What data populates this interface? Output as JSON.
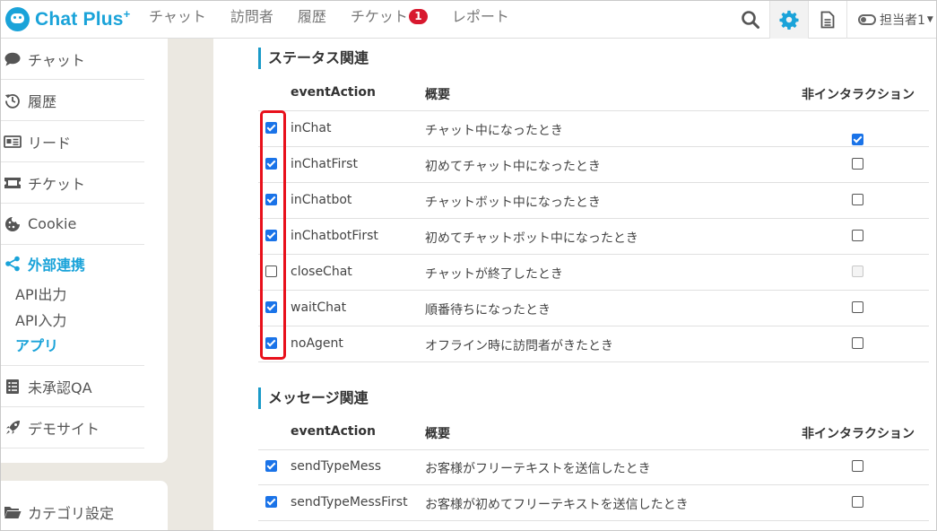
{
  "header": {
    "app_name": "Chat Plus",
    "app_plus": "+",
    "nav": [
      {
        "label": "チャット"
      },
      {
        "label": "訪問者"
      },
      {
        "label": "履歴"
      },
      {
        "label": "チケット",
        "badge": "1"
      },
      {
        "label": "レポート"
      }
    ],
    "user_label": "担当者1"
  },
  "sidebar": {
    "items": [
      {
        "label": "チャット",
        "icon": "speech-bubble-icon"
      },
      {
        "label": "履歴",
        "icon": "history-icon"
      },
      {
        "label": "リード",
        "icon": "id-card-icon"
      },
      {
        "label": "チケット",
        "icon": "ticket-icon"
      },
      {
        "label": "Cookie",
        "icon": "cookie-icon"
      },
      {
        "label": "外部連携",
        "icon": "share-icon",
        "active": true
      },
      {
        "label": "未承認QA",
        "icon": "checklist-icon"
      },
      {
        "label": "デモサイト",
        "icon": "rocket-icon"
      }
    ],
    "sub_items": [
      {
        "label": "API出力"
      },
      {
        "label": "API入力"
      },
      {
        "label": "アプリ",
        "active": true
      }
    ],
    "bottom_item": {
      "label": "カテゴリ設定",
      "icon": "folder-icon"
    }
  },
  "sections": [
    {
      "title": "ステータス関連",
      "columns": {
        "event": "eventAction",
        "desc": "概要",
        "noninteraction": "非インタラクション"
      },
      "rows": [
        {
          "enabled": true,
          "event": "inChat",
          "desc": "チャット中になったとき",
          "noninteraction": "checked"
        },
        {
          "enabled": true,
          "event": "inChatFirst",
          "desc": "初めてチャット中になったとき",
          "noninteraction": "unchecked"
        },
        {
          "enabled": true,
          "event": "inChatbot",
          "desc": "チャットボット中になったとき",
          "noninteraction": "unchecked"
        },
        {
          "enabled": true,
          "event": "inChatbotFirst",
          "desc": "初めてチャットボット中になったとき",
          "noninteraction": "unchecked"
        },
        {
          "enabled": false,
          "event": "closeChat",
          "desc": "チャットが終了したとき",
          "noninteraction": "disabled"
        },
        {
          "enabled": true,
          "event": "waitChat",
          "desc": "順番待ちになったとき",
          "noninteraction": "unchecked"
        },
        {
          "enabled": true,
          "event": "noAgent",
          "desc": "オフライン時に訪問者がきたとき",
          "noninteraction": "unchecked"
        }
      ]
    },
    {
      "title": "メッセージ関連",
      "columns": {
        "event": "eventAction",
        "desc": "概要",
        "noninteraction": "非インタラクション"
      },
      "rows": [
        {
          "enabled": true,
          "event": "sendTypeMess",
          "desc": "お客様がフリーテキストを送信したとき",
          "noninteraction": "unchecked"
        },
        {
          "enabled": true,
          "event": "sendTypeMessFirst",
          "desc": "お客様が初めてフリーテキストを送信したとき",
          "noninteraction": "unchecked"
        }
      ]
    }
  ],
  "colors": {
    "accent": "#1aa3d9",
    "highlight": "#e8101b",
    "badge": "#d8182e",
    "checkbox": "#1a73e8"
  }
}
